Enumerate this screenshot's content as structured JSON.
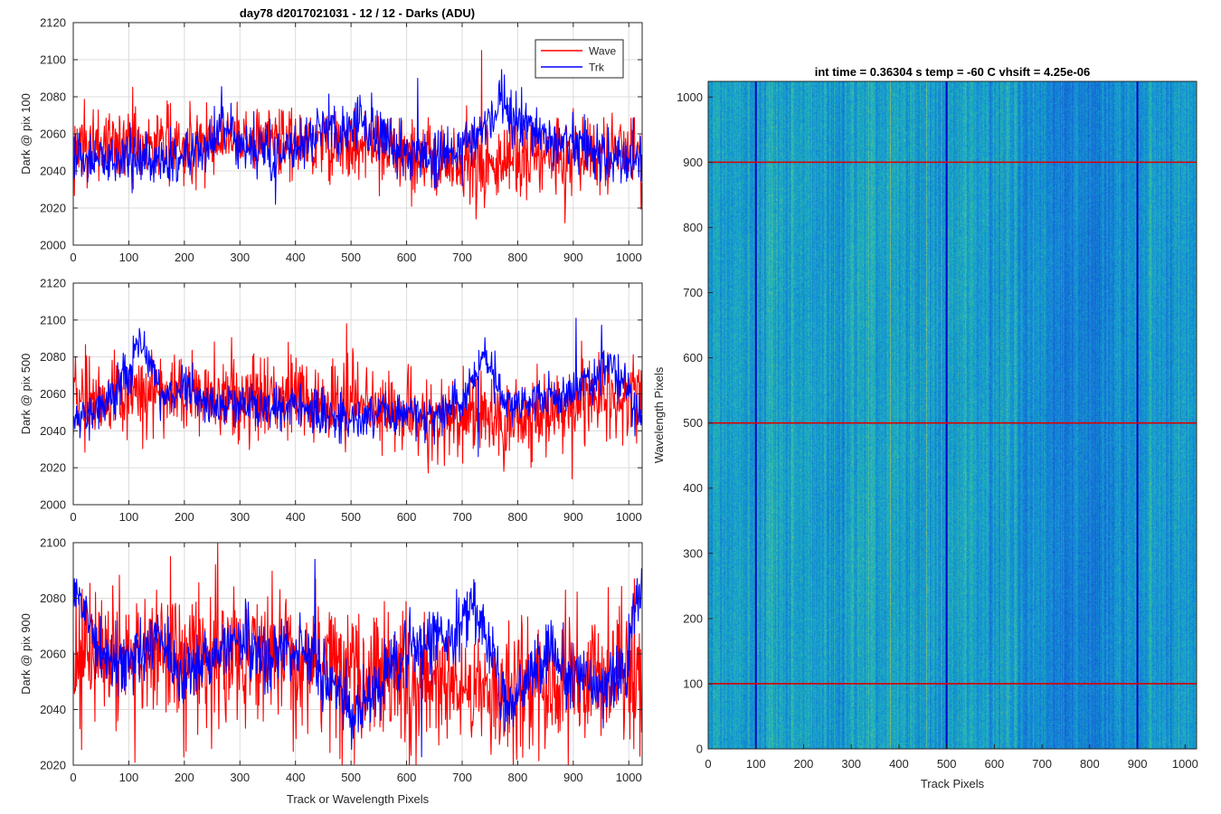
{
  "figure": {
    "title": "day78 d2017021031 - 12 / 12 - Darks (ADU)"
  },
  "chart_data": [
    {
      "type": "line",
      "ylabel": "Dark @ pix 100",
      "xlabel": "",
      "xlim": [
        0,
        1024
      ],
      "ylim": [
        2000,
        2120
      ],
      "xticks": [
        0,
        100,
        200,
        300,
        400,
        500,
        600,
        700,
        800,
        900,
        1000
      ],
      "yticks": [
        2000,
        2020,
        2040,
        2060,
        2080,
        2100,
        2120
      ],
      "grid": true,
      "legend": {
        "position": "top-right",
        "entries": [
          "Wave",
          "Trk"
        ]
      },
      "series": [
        {
          "name": "Wave",
          "color": "#ff0000",
          "noise": 10,
          "spike_max": 2105,
          "spike_min": 2012,
          "trend": [
            [
              0,
              2052
            ],
            [
              100,
              2055
            ],
            [
              200,
              2055
            ],
            [
              300,
              2058
            ],
            [
              400,
              2058
            ],
            [
              500,
              2054
            ],
            [
              600,
              2048
            ],
            [
              700,
              2043
            ],
            [
              800,
              2046
            ],
            [
              900,
              2050
            ],
            [
              1024,
              2052
            ]
          ]
        },
        {
          "name": "Trk",
          "color": "#0000ff",
          "noise": 7,
          "spike_max": 2090,
          "spike_min": 2022,
          "trend": [
            [
              0,
              2046
            ],
            [
              100,
              2046
            ],
            [
              200,
              2046
            ],
            [
              240,
              2055
            ],
            [
              270,
              2070
            ],
            [
              300,
              2055
            ],
            [
              360,
              2048
            ],
            [
              420,
              2055
            ],
            [
              450,
              2062
            ],
            [
              480,
              2060
            ],
            [
              520,
              2066
            ],
            [
              560,
              2056
            ],
            [
              600,
              2050
            ],
            [
              650,
              2047
            ],
            [
              700,
              2052
            ],
            [
              740,
              2065
            ],
            [
              770,
              2075
            ],
            [
              800,
              2068
            ],
            [
              850,
              2060
            ],
            [
              900,
              2055
            ],
            [
              950,
              2048
            ],
            [
              1024,
              2045
            ]
          ]
        }
      ]
    },
    {
      "type": "line",
      "ylabel": "Dark @ pix 500",
      "xlabel": "",
      "xlim": [
        0,
        1024
      ],
      "ylim": [
        2000,
        2120
      ],
      "xticks": [
        0,
        100,
        200,
        300,
        400,
        500,
        600,
        700,
        800,
        900,
        1000
      ],
      "yticks": [
        2000,
        2020,
        2040,
        2060,
        2080,
        2100,
        2120
      ],
      "grid": true,
      "series": [
        {
          "name": "Wave",
          "color": "#ff0000",
          "noise": 11,
          "spike_max": 2098,
          "spike_min": 2014,
          "trend": [
            [
              0,
              2057
            ],
            [
              100,
              2058
            ],
            [
              200,
              2060
            ],
            [
              300,
              2058
            ],
            [
              400,
              2058
            ],
            [
              500,
              2054
            ],
            [
              600,
              2050
            ],
            [
              700,
              2046
            ],
            [
              800,
              2048
            ],
            [
              900,
              2055
            ],
            [
              1024,
              2058
            ]
          ]
        },
        {
          "name": "Trk",
          "color": "#0000ff",
          "noise": 6,
          "spike_max": 2101,
          "spike_min": 2026,
          "trend": [
            [
              0,
              2045
            ],
            [
              60,
              2052
            ],
            [
              100,
              2072
            ],
            [
              120,
              2090
            ],
            [
              140,
              2078
            ],
            [
              160,
              2058
            ],
            [
              200,
              2066
            ],
            [
              250,
              2052
            ],
            [
              300,
              2055
            ],
            [
              350,
              2050
            ],
            [
              400,
              2055
            ],
            [
              450,
              2050
            ],
            [
              500,
              2046
            ],
            [
              550,
              2052
            ],
            [
              600,
              2050
            ],
            [
              650,
              2050
            ],
            [
              700,
              2058
            ],
            [
              740,
              2082
            ],
            [
              770,
              2060
            ],
            [
              800,
              2055
            ],
            [
              850,
              2058
            ],
            [
              900,
              2060
            ],
            [
              950,
              2075
            ],
            [
              990,
              2068
            ],
            [
              1024,
              2045
            ]
          ]
        }
      ]
    },
    {
      "type": "line",
      "ylabel": "Dark @ pix 900",
      "xlabel": "Track or Wavelength Pixels",
      "xlim": [
        0,
        1024
      ],
      "ylim": [
        2020,
        2100
      ],
      "xticks": [
        0,
        100,
        200,
        300,
        400,
        500,
        600,
        700,
        800,
        900,
        1000
      ],
      "yticks": [
        2020,
        2040,
        2060,
        2080,
        2100
      ],
      "grid": true,
      "series": [
        {
          "name": "Wave",
          "color": "#ff0000",
          "noise": 12,
          "spike_max": 2100,
          "spike_min": 2021,
          "trend": [
            [
              0,
              2058
            ],
            [
              100,
              2060
            ],
            [
              200,
              2058
            ],
            [
              300,
              2058
            ],
            [
              400,
              2058
            ],
            [
              500,
              2056
            ],
            [
              600,
              2052
            ],
            [
              700,
              2046
            ],
            [
              800,
              2046
            ],
            [
              900,
              2052
            ],
            [
              1024,
              2055
            ]
          ]
        },
        {
          "name": "Trk",
          "color": "#0000ff",
          "noise": 6,
          "spike_max": 2094,
          "spike_min": 2023,
          "trend": [
            [
              0,
              2085
            ],
            [
              40,
              2062
            ],
            [
              80,
              2055
            ],
            [
              120,
              2060
            ],
            [
              160,
              2065
            ],
            [
              200,
              2050
            ],
            [
              260,
              2062
            ],
            [
              300,
              2066
            ],
            [
              340,
              2058
            ],
            [
              380,
              2062
            ],
            [
              430,
              2058
            ],
            [
              480,
              2046
            ],
            [
              510,
              2040
            ],
            [
              550,
              2048
            ],
            [
              600,
              2060
            ],
            [
              650,
              2066
            ],
            [
              700,
              2070
            ],
            [
              720,
              2080
            ],
            [
              750,
              2062
            ],
            [
              780,
              2040
            ],
            [
              820,
              2052
            ],
            [
              860,
              2060
            ],
            [
              900,
              2052
            ],
            [
              950,
              2046
            ],
            [
              990,
              2052
            ],
            [
              1024,
              2088
            ]
          ]
        }
      ]
    },
    {
      "type": "heatmap",
      "title": "int time = 0.36304 s    temp = -60 C    vhsift = 4.25e-06",
      "xlabel": "Track Pixels",
      "ylabel": "Wavelength Pixels",
      "xlim": [
        0,
        1024
      ],
      "ylim": [
        0,
        1024
      ],
      "xticks": [
        0,
        100,
        200,
        300,
        400,
        500,
        600,
        700,
        800,
        900,
        1000
      ],
      "yticks": [
        0,
        100,
        200,
        300,
        400,
        500,
        600,
        700,
        800,
        900,
        1000
      ],
      "colormap": "parula",
      "base_color": "#1fa2c7",
      "vertical_markers": {
        "values": [
          100,
          500,
          900
        ],
        "color": "#0000cc"
      },
      "horizontal_markers": {
        "values": [
          100,
          500,
          900
        ],
        "color": "#dd0000"
      }
    }
  ]
}
